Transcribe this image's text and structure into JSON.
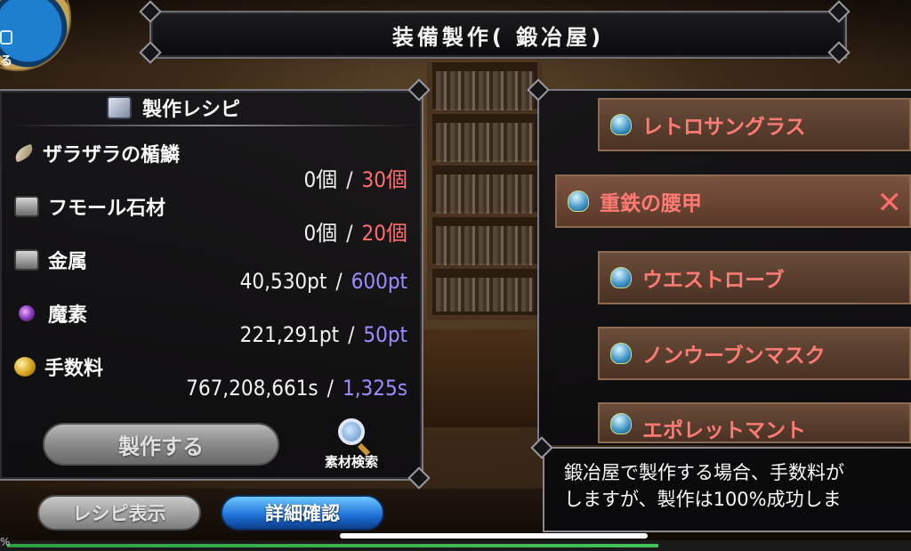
{
  "title": "装備製作( 鍛冶屋)",
  "corner_emblem": {
    "label": "る",
    "icon": "menu-icon"
  },
  "recipe": {
    "header": "製作レシピ",
    "materials": [
      {
        "name": "ザラザラの楯鱗",
        "icon": "claw-icon",
        "have": "0個",
        "need": "30個",
        "need_color": "#ff6d6d"
      },
      {
        "name": "フモール石材",
        "icon": "stone-icon",
        "have": "0個",
        "need": "20個",
        "need_color": "#ff6d6d"
      },
      {
        "name": "金属",
        "icon": "metal-icon",
        "have": "40,530pt",
        "need": "600pt",
        "need_color": "#9d8cff"
      },
      {
        "name": "魔素",
        "icon": "orb-icon",
        "have": "221,291pt",
        "need": "50pt",
        "need_color": "#9d8cff"
      },
      {
        "name": "手数料",
        "icon": "coins-icon",
        "have": "767,208,661s",
        "need": "1,325s",
        "need_color": "#9d8cff"
      }
    ],
    "separator": "/",
    "craft_button": "製作する",
    "search_button": "素材検索"
  },
  "buttons": {
    "recipe_view": "レシピ表示",
    "detail": "詳細確認"
  },
  "items": [
    {
      "name": "レトロサングラス",
      "selected": false
    },
    {
      "name": "重鉄の腰甲",
      "selected": true
    },
    {
      "name": "ウエストローブ",
      "selected": false
    },
    {
      "name": "ノンウーブンマスク",
      "selected": false
    },
    {
      "name": "エポレットマント",
      "selected": false
    }
  ],
  "close_glyph": "✕",
  "message": {
    "line1": "鍛冶屋で製作する場合、手数料が",
    "line2": "しますが、製作は100%成功しま"
  },
  "progress": {
    "label": "%",
    "value": 0.72
  },
  "colors": {
    "accent_red": "#ff6d6d",
    "accent_blue": "#9d8cff",
    "detail_button": "#1d6fd6"
  }
}
